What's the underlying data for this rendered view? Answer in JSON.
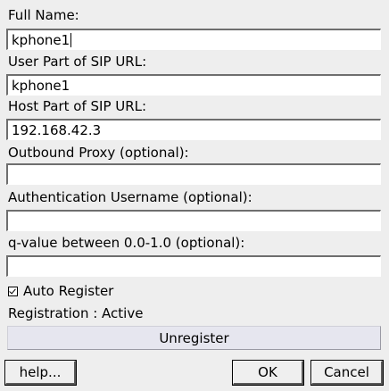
{
  "fields": {
    "full_name": {
      "label": "Full Name:",
      "value": "kphone1"
    },
    "user_part": {
      "label": "User Part of SIP URL:",
      "value": "kphone1"
    },
    "host_part": {
      "label": "Host Part of SIP URL:",
      "value": "192.168.42.3"
    },
    "outbound_proxy": {
      "label": "Outbound Proxy (optional):",
      "value": ""
    },
    "auth_username": {
      "label": "Authentication Username (optional):",
      "value": ""
    },
    "q_value": {
      "label": "q-value between 0.0-1.0 (optional):",
      "value": ""
    }
  },
  "auto_register": {
    "label": "Auto Register",
    "checked": true
  },
  "registration_status": "Registration : Active",
  "buttons": {
    "unregister": "Unregister",
    "help": "help...",
    "ok": "OK",
    "cancel": "Cancel"
  }
}
